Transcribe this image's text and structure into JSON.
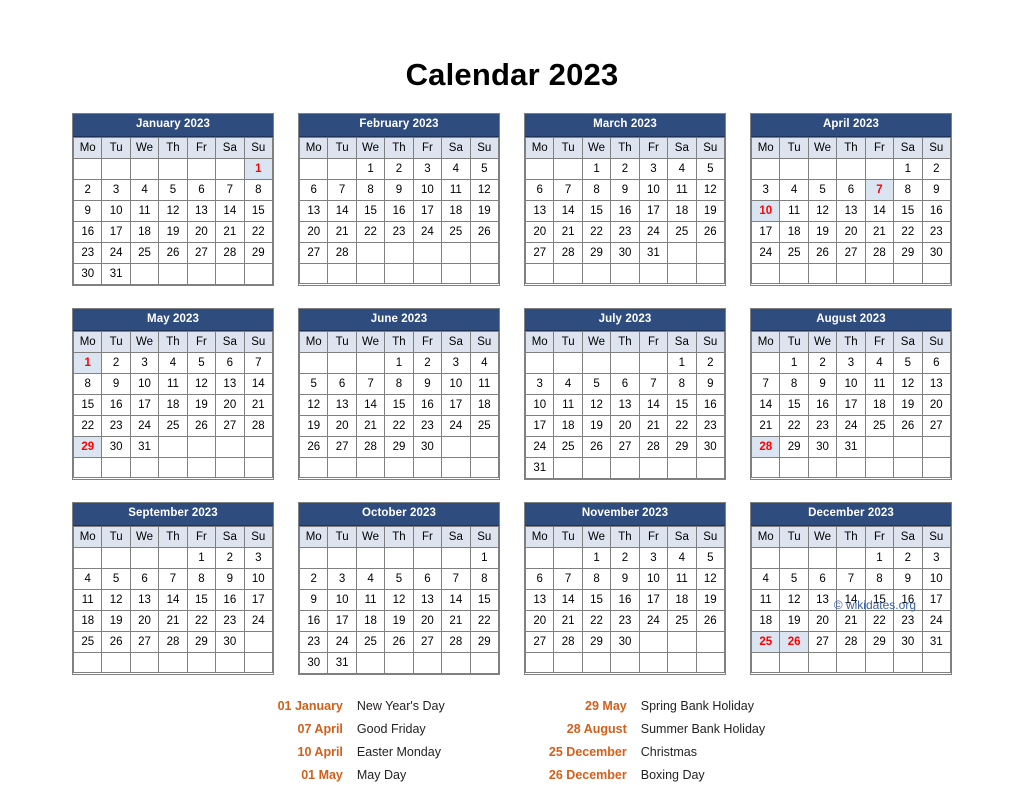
{
  "page": {
    "title": "Calendar 2023",
    "watermark": "© wikidates.org",
    "accent_header_color": "#2e4c7e",
    "holiday_text_color": "#ff0000",
    "holiday_cell_color": "#dbe5f1",
    "legend_date_color": "#d2601a",
    "weekday_row_color": "#dde4ef"
  },
  "weekdays": [
    "Mo",
    "Tu",
    "We",
    "Th",
    "Fr",
    "Sa",
    "Su"
  ],
  "calendar_data": {
    "year": 2023,
    "week_start": "Monday",
    "months": [
      {
        "name": "January 2023",
        "weeks": [
          [
            "",
            "",
            "",
            "",
            "",
            "",
            "1"
          ],
          [
            "2",
            "3",
            "4",
            "5",
            "6",
            "7",
            "8"
          ],
          [
            "9",
            "10",
            "11",
            "12",
            "13",
            "14",
            "15"
          ],
          [
            "16",
            "17",
            "18",
            "19",
            "20",
            "21",
            "22"
          ],
          [
            "23",
            "24",
            "25",
            "26",
            "27",
            "28",
            "29"
          ],
          [
            "30",
            "31",
            "",
            "",
            "",
            "",
            ""
          ]
        ],
        "holidays": [
          "1"
        ]
      },
      {
        "name": "February 2023",
        "weeks": [
          [
            "",
            "",
            "1",
            "2",
            "3",
            "4",
            "5"
          ],
          [
            "6",
            "7",
            "8",
            "9",
            "10",
            "11",
            "12"
          ],
          [
            "13",
            "14",
            "15",
            "16",
            "17",
            "18",
            "19"
          ],
          [
            "20",
            "21",
            "22",
            "23",
            "24",
            "25",
            "26"
          ],
          [
            "27",
            "28",
            "",
            "",
            "",
            "",
            ""
          ],
          [
            "",
            "",
            "",
            "",
            "",
            "",
            ""
          ]
        ],
        "holidays": []
      },
      {
        "name": "March 2023",
        "weeks": [
          [
            "",
            "",
            "1",
            "2",
            "3",
            "4",
            "5"
          ],
          [
            "6",
            "7",
            "8",
            "9",
            "10",
            "11",
            "12"
          ],
          [
            "13",
            "14",
            "15",
            "16",
            "17",
            "18",
            "19"
          ],
          [
            "20",
            "21",
            "22",
            "23",
            "24",
            "25",
            "26"
          ],
          [
            "27",
            "28",
            "29",
            "30",
            "31",
            "",
            ""
          ],
          [
            "",
            "",
            "",
            "",
            "",
            "",
            ""
          ]
        ],
        "holidays": []
      },
      {
        "name": "April 2023",
        "weeks": [
          [
            "",
            "",
            "",
            "",
            "",
            "1",
            "2"
          ],
          [
            "3",
            "4",
            "5",
            "6",
            "7",
            "8",
            "9"
          ],
          [
            "10",
            "11",
            "12",
            "13",
            "14",
            "15",
            "16"
          ],
          [
            "17",
            "18",
            "19",
            "20",
            "21",
            "22",
            "23"
          ],
          [
            "24",
            "25",
            "26",
            "27",
            "28",
            "29",
            "30"
          ],
          [
            "",
            "",
            "",
            "",
            "",
            "",
            ""
          ]
        ],
        "holidays": [
          "7",
          "10"
        ]
      },
      {
        "name": "May 2023",
        "weeks": [
          [
            "1",
            "2",
            "3",
            "4",
            "5",
            "6",
            "7"
          ],
          [
            "8",
            "9",
            "10",
            "11",
            "12",
            "13",
            "14"
          ],
          [
            "15",
            "16",
            "17",
            "18",
            "19",
            "20",
            "21"
          ],
          [
            "22",
            "23",
            "24",
            "25",
            "26",
            "27",
            "28"
          ],
          [
            "29",
            "30",
            "31",
            "",
            "",
            "",
            ""
          ],
          [
            "",
            "",
            "",
            "",
            "",
            "",
            ""
          ]
        ],
        "holidays": [
          "1",
          "29"
        ]
      },
      {
        "name": "June 2023",
        "weeks": [
          [
            "",
            "",
            "",
            "1",
            "2",
            "3",
            "4"
          ],
          [
            "5",
            "6",
            "7",
            "8",
            "9",
            "10",
            "11"
          ],
          [
            "12",
            "13",
            "14",
            "15",
            "16",
            "17",
            "18"
          ],
          [
            "19",
            "20",
            "21",
            "22",
            "23",
            "24",
            "25"
          ],
          [
            "26",
            "27",
            "28",
            "29",
            "30",
            "",
            ""
          ],
          [
            "",
            "",
            "",
            "",
            "",
            "",
            ""
          ]
        ],
        "holidays": []
      },
      {
        "name": "July 2023",
        "weeks": [
          [
            "",
            "",
            "",
            "",
            "",
            "1",
            "2"
          ],
          [
            "3",
            "4",
            "5",
            "6",
            "7",
            "8",
            "9"
          ],
          [
            "10",
            "11",
            "12",
            "13",
            "14",
            "15",
            "16"
          ],
          [
            "17",
            "18",
            "19",
            "20",
            "21",
            "22",
            "23"
          ],
          [
            "24",
            "25",
            "26",
            "27",
            "28",
            "29",
            "30"
          ],
          [
            "31",
            "",
            "",
            "",
            "",
            "",
            ""
          ]
        ],
        "holidays": []
      },
      {
        "name": "August 2023",
        "weeks": [
          [
            "",
            "1",
            "2",
            "3",
            "4",
            "5",
            "6"
          ],
          [
            "7",
            "8",
            "9",
            "10",
            "11",
            "12",
            "13"
          ],
          [
            "14",
            "15",
            "16",
            "17",
            "18",
            "19",
            "20"
          ],
          [
            "21",
            "22",
            "23",
            "24",
            "25",
            "26",
            "27"
          ],
          [
            "28",
            "29",
            "30",
            "31",
            "",
            "",
            ""
          ],
          [
            "",
            "",
            "",
            "",
            "",
            "",
            ""
          ]
        ],
        "holidays": [
          "28"
        ]
      },
      {
        "name": "September 2023",
        "weeks": [
          [
            "",
            "",
            "",
            "",
            "1",
            "2",
            "3"
          ],
          [
            "4",
            "5",
            "6",
            "7",
            "8",
            "9",
            "10"
          ],
          [
            "11",
            "12",
            "13",
            "14",
            "15",
            "16",
            "17"
          ],
          [
            "18",
            "19",
            "20",
            "21",
            "22",
            "23",
            "24"
          ],
          [
            "25",
            "26",
            "27",
            "28",
            "29",
            "30",
            ""
          ],
          [
            "",
            "",
            "",
            "",
            "",
            "",
            ""
          ]
        ],
        "holidays": []
      },
      {
        "name": "October 2023",
        "weeks": [
          [
            "",
            "",
            "",
            "",
            "",
            "",
            "1"
          ],
          [
            "2",
            "3",
            "4",
            "5",
            "6",
            "7",
            "8"
          ],
          [
            "9",
            "10",
            "11",
            "12",
            "13",
            "14",
            "15"
          ],
          [
            "16",
            "17",
            "18",
            "19",
            "20",
            "21",
            "22"
          ],
          [
            "23",
            "24",
            "25",
            "26",
            "27",
            "28",
            "29"
          ],
          [
            "30",
            "31",
            "",
            "",
            "",
            "",
            ""
          ]
        ],
        "holidays": []
      },
      {
        "name": "November 2023",
        "weeks": [
          [
            "",
            "",
            "1",
            "2",
            "3",
            "4",
            "5"
          ],
          [
            "6",
            "7",
            "8",
            "9",
            "10",
            "11",
            "12"
          ],
          [
            "13",
            "14",
            "15",
            "16",
            "17",
            "18",
            "19"
          ],
          [
            "20",
            "21",
            "22",
            "23",
            "24",
            "25",
            "26"
          ],
          [
            "27",
            "28",
            "29",
            "30",
            "",
            "",
            ""
          ],
          [
            "",
            "",
            "",
            "",
            "",
            "",
            ""
          ]
        ],
        "holidays": []
      },
      {
        "name": "December 2023",
        "weeks": [
          [
            "",
            "",
            "",
            "",
            "1",
            "2",
            "3"
          ],
          [
            "4",
            "5",
            "6",
            "7",
            "8",
            "9",
            "10"
          ],
          [
            "11",
            "12",
            "13",
            "14",
            "15",
            "16",
            "17"
          ],
          [
            "18",
            "19",
            "20",
            "21",
            "22",
            "23",
            "24"
          ],
          [
            "25",
            "26",
            "27",
            "28",
            "29",
            "30",
            "31"
          ],
          [
            "",
            "",
            "",
            "",
            "",
            "",
            ""
          ]
        ],
        "holidays": [
          "25",
          "26"
        ]
      }
    ]
  },
  "legend": {
    "columns": [
      [
        {
          "date": "01 January",
          "name": "New Year's Day"
        },
        {
          "date": "07 April",
          "name": "Good Friday"
        },
        {
          "date": "10 April",
          "name": "Easter Monday"
        },
        {
          "date": "01 May",
          "name": "May Day"
        }
      ],
      [
        {
          "date": "29 May",
          "name": "Spring Bank Holiday"
        },
        {
          "date": "28 August",
          "name": "Summer Bank Holiday"
        },
        {
          "date": "25 December",
          "name": "Christmas"
        },
        {
          "date": "26 December",
          "name": "Boxing Day"
        }
      ]
    ]
  }
}
